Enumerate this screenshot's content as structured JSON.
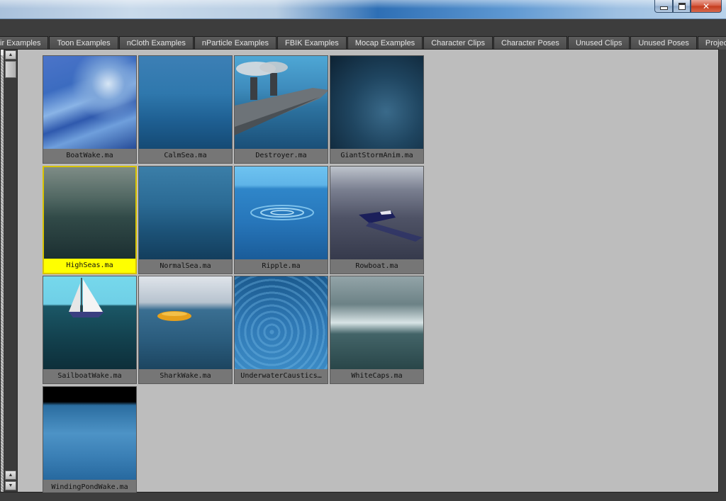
{
  "window": {
    "minimize_icon": "minimize-icon",
    "maximize_icon": "maximize-icon",
    "close_label": "✕"
  },
  "tabs": [
    {
      "label": "ir Examples"
    },
    {
      "label": "Toon Examples"
    },
    {
      "label": "nCloth Examples"
    },
    {
      "label": "nParticle Examples"
    },
    {
      "label": "FBIK Examples"
    },
    {
      "label": "Mocap Examples"
    },
    {
      "label": "Character Clips"
    },
    {
      "label": "Character Poses"
    },
    {
      "label": "Unused Clips"
    },
    {
      "label": "Unused Poses"
    },
    {
      "label": "Projects"
    }
  ],
  "scrollbar": {
    "up_icon": "▲",
    "down_icon": "▼",
    "top_up_icon": "▲"
  },
  "files": [
    {
      "name": "BoatWake.ma"
    },
    {
      "name": "CalmSea.ma"
    },
    {
      "name": "Destroyer.ma"
    },
    {
      "name": "GiantStormAnim.ma"
    },
    {
      "name": "HighSeas.ma"
    },
    {
      "name": "NormalSea.ma"
    },
    {
      "name": "Ripple.ma"
    },
    {
      "name": "Rowboat.ma"
    },
    {
      "name": "SailboatWake.ma"
    },
    {
      "name": "SharkWake.ma"
    },
    {
      "name": "UnderwaterCaustics…"
    },
    {
      "name": "WhiteCaps.ma"
    },
    {
      "name": "WindingPondWake.ma"
    }
  ],
  "selected_file": "HighSeas.ma",
  "colors": {
    "selection_highlight": "#ffff00",
    "panel_background": "#bdbdbd",
    "tab_background": "#4b4b4b"
  }
}
